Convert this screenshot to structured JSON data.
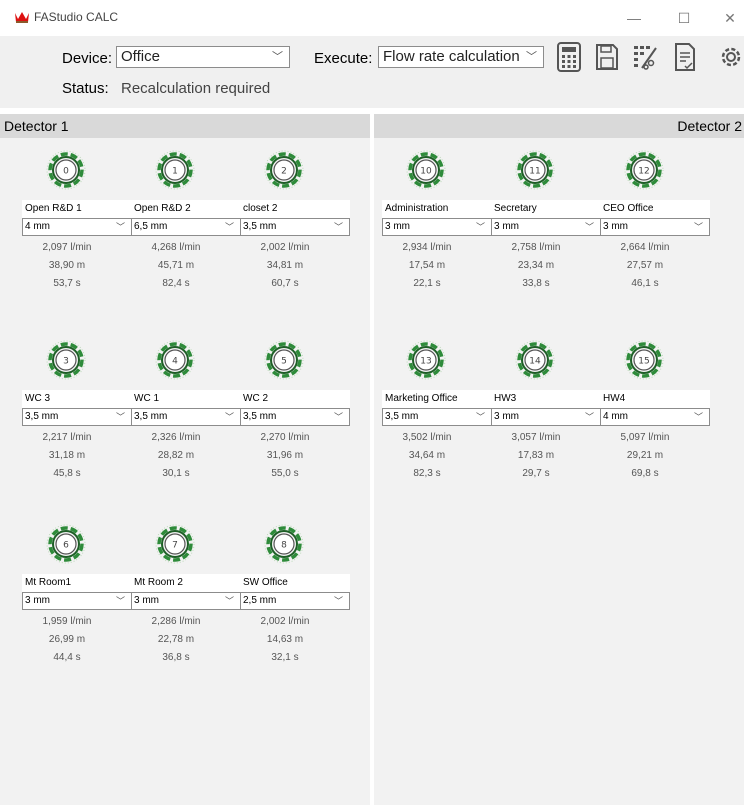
{
  "window": {
    "title": "FAStudio CALC",
    "controls": [
      "—",
      "☐",
      "✕"
    ]
  },
  "toolbar": {
    "device_label": "Device:",
    "device_value": "Office",
    "execute_label": "Execute:",
    "execute_value": "Flow rate calculation",
    "status_label": "Status:",
    "status_value": "Recalculation required",
    "icons": [
      "calculator-icon",
      "save-icon",
      "bom-icon",
      "report-icon",
      "settings-icon"
    ]
  },
  "panels": [
    {
      "title": "Detector 1",
      "detectors": [
        {
          "num": "0",
          "name": "Open R&D 1",
          "diameter": "4 mm",
          "flow": "2,097 l/min",
          "length": "38,90 m",
          "time": "53,7 s"
        },
        {
          "num": "1",
          "name": "Open R&D 2",
          "diameter": "6,5 mm",
          "flow": "4,268 l/min",
          "length": "45,71 m",
          "time": "82,4 s"
        },
        {
          "num": "2",
          "name": "closet 2",
          "diameter": "3,5 mm",
          "flow": "2,002 l/min",
          "length": "34,81 m",
          "time": "60,7 s"
        },
        {
          "num": "3",
          "name": "WC 3",
          "diameter": "3,5 mm",
          "flow": "2,217 l/min",
          "length": "31,18 m",
          "time": "45,8 s"
        },
        {
          "num": "4",
          "name": "WC 1",
          "diameter": "3,5 mm",
          "flow": "2,326 l/min",
          "length": "28,82 m",
          "time": "30,1 s"
        },
        {
          "num": "5",
          "name": "WC 2",
          "diameter": "3,5 mm",
          "flow": "2,270 l/min",
          "length": "31,96 m",
          "time": "55,0 s"
        },
        {
          "num": "6",
          "name": "Mt Room1",
          "diameter": "3 mm",
          "flow": "1,959 l/min",
          "length": "26,99 m",
          "time": "44,4 s"
        },
        {
          "num": "7",
          "name": "Mt Room 2",
          "diameter": "3 mm",
          "flow": "2,286 l/min",
          "length": "22,78 m",
          "time": "36,8 s"
        },
        {
          "num": "8",
          "name": "SW Office",
          "diameter": "2,5 mm",
          "flow": "2,002 l/min",
          "length": "14,63 m",
          "time": "32,1 s"
        }
      ]
    },
    {
      "title": "Detector 2",
      "detectors": [
        {
          "num": "10",
          "name": "Administration",
          "diameter": "3 mm",
          "flow": "2,934 l/min",
          "length": "17,54 m",
          "time": "22,1 s"
        },
        {
          "num": "11",
          "name": "Secretary",
          "diameter": "3 mm",
          "flow": "2,758 l/min",
          "length": "23,34 m",
          "time": "33,8 s"
        },
        {
          "num": "12",
          "name": "CEO Office",
          "diameter": "3 mm",
          "flow": "2,664 l/min",
          "length": "27,57 m",
          "time": "46,1 s"
        },
        {
          "num": "13",
          "name": "Marketing Office",
          "diameter": "3,5 mm",
          "flow": "3,502 l/min",
          "length": "34,64 m",
          "time": "82,3 s"
        },
        {
          "num": "14",
          "name": "HW3",
          "diameter": "3 mm",
          "flow": "3,057 l/min",
          "length": "17,83 m",
          "time": "29,7 s"
        },
        {
          "num": "15",
          "name": "HW4",
          "diameter": "4 mm",
          "flow": "5,097 l/min",
          "length": "29,21 m",
          "time": "69,8 s"
        }
      ]
    }
  ],
  "colors": {
    "accent_green": "#2e8b3a",
    "panel_header": "#d9d9d9",
    "panel_bg": "#f2f2f2"
  }
}
